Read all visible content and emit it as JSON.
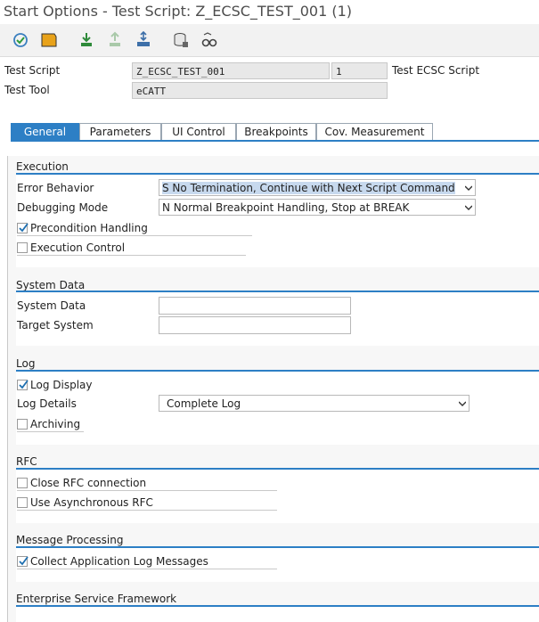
{
  "window": {
    "title": "Start Options - Test Script: Z_ECSC_TEST_001 (1)"
  },
  "toolbar": {
    "icons": [
      "execute-check-icon",
      "variant-folder-icon",
      "download-icon",
      "upload-icon",
      "transport-icon",
      "database-icon",
      "glasses-icon"
    ]
  },
  "header": {
    "test_script_label": "Test Script",
    "test_script_value": "Z_ECSC_TEST_001",
    "version_value": "1",
    "test_script_desc": "Test ECSC Script",
    "test_tool_label": "Test Tool",
    "test_tool_value": "eCATT"
  },
  "tabs": [
    {
      "label": "General",
      "active": true
    },
    {
      "label": "Parameters",
      "active": false
    },
    {
      "label": "UI Control",
      "active": false
    },
    {
      "label": "Breakpoints",
      "active": false
    },
    {
      "label": "Cov. Measurement",
      "active": false
    }
  ],
  "execution": {
    "title": "Execution",
    "error_behavior_label": "Error Behavior",
    "error_behavior_value": "S No Termination, Continue with Next Script Command",
    "debugging_mode_label": "Debugging Mode",
    "debugging_mode_value": "N Normal Breakpoint Handling, Stop at BREAK",
    "precondition_label": "Precondition Handling",
    "precondition_checked": true,
    "execution_control_label": "Execution Control",
    "execution_control_checked": false
  },
  "system_data": {
    "title": "System Data",
    "system_data_label": "System Data",
    "system_data_value": "",
    "target_system_label": "Target System",
    "target_system_value": ""
  },
  "log": {
    "title": "Log",
    "log_display_label": "Log Display",
    "log_display_checked": true,
    "log_details_label": "Log Details",
    "log_details_value": "Complete Log",
    "archiving_label": "Archiving",
    "archiving_checked": false
  },
  "rfc": {
    "title": "RFC",
    "close_rfc_label": "Close RFC connection",
    "close_rfc_checked": false,
    "async_rfc_label": "Use Asynchronous RFC",
    "async_rfc_checked": false
  },
  "message_processing": {
    "title": "Message Processing",
    "collect_label": "Collect Application Log Messages",
    "collect_checked": true
  },
  "esf": {
    "title": "Enterprise Service Framework"
  },
  "colors": {
    "accent": "#2d7fc5",
    "panel_bg": "#f7f7f7",
    "field_bg": "#e8e8e8"
  }
}
